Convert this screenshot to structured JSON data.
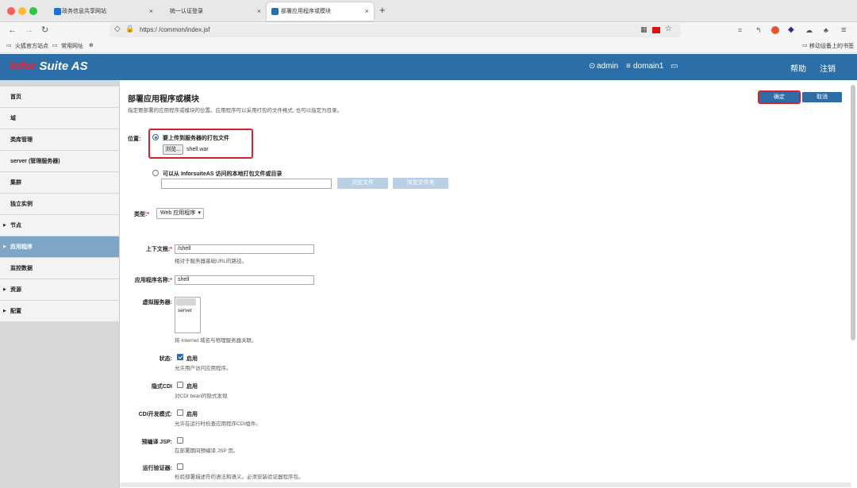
{
  "browser": {
    "tabs": [
      {
        "label": "政务信息共享网站",
        "close": "×"
      },
      {
        "label": "统一认证登录",
        "close": "×"
      },
      {
        "label": "部署应用程序或模块",
        "close": "×"
      }
    ],
    "new_tab": "+",
    "url": "https:/                    /common/index.jsf",
    "bookmarks": [
      "火狐官方站点",
      "常用网址"
    ],
    "mobile_bookmarks": "移动设备上的书签",
    "colors": {
      "tab_bg": "#e8e8e8",
      "dot_red": "#ff5f57",
      "dot_yellow": "#febc2e",
      "dot_green": "#28c840"
    }
  },
  "app": {
    "logo_prefix": "In",
    "logo_mark": "for",
    "logo_suffix": " Suite AS",
    "user": "admin",
    "domain": "domain1",
    "host": "",
    "help": "帮助",
    "logout": "注销",
    "header_color": "#2c6fa8"
  },
  "sidebar": {
    "items": [
      {
        "label": "首页",
        "arrow": ""
      },
      {
        "label": "域",
        "arrow": ""
      },
      {
        "label": "类库管理",
        "arrow": ""
      },
      {
        "label": "server (管理服务器)",
        "arrow": ""
      },
      {
        "label": "集群",
        "arrow": ""
      },
      {
        "label": "独立实例",
        "arrow": ""
      },
      {
        "label": "节点",
        "arrow": "▶"
      },
      {
        "label": "应用程序",
        "arrow": "▶"
      },
      {
        "label": "监控数据",
        "arrow": ""
      },
      {
        "label": "资源",
        "arrow": "▶"
      },
      {
        "label": "配置",
        "arrow": "▶"
      }
    ],
    "selected_index": 7
  },
  "form": {
    "title": "部署应用程序或模块",
    "description": "指定要部署的应用程序或模块的位置。应用程序可以采用打包的文件格式, 也可以指定为目录。",
    "ok": "确定",
    "cancel": "取消",
    "location_label": "位置:",
    "upload_option": "要上传到服务器的打包文件",
    "browse": "浏览...",
    "file_name": "shell.war",
    "local_option": "可以从 InforsuiteAS 访问的本地打包文件或目录",
    "browse_file": "浏览文件",
    "browse_folder": "浏览文件夹",
    "type_label": "类型:",
    "type_value": "Web 应用程序",
    "context_label": "上下文根:",
    "context_value": "/shell",
    "context_help": "相对于服务器基础URL的路径。",
    "appname_label": "应用程序名称:",
    "appname_value": "shell",
    "vserver_label": "虚拟服务器:",
    "vserver_option": "server",
    "vserver_help": "将 Internet 域名与物理服务器关联。",
    "status_label": "状态:",
    "status_check": "启用",
    "status_help": "允许用户访问应用程序。",
    "cdi_label": "隐式CDI",
    "cdi_check": "启用",
    "cdi_help": "对CDI bean的隐式发现",
    "cdidev_label": "CDI开发模式:",
    "cdidev_check": "启用",
    "cdidev_help": "允许在运行时检查应用程序CDI组件。",
    "jsp_label": "预编译 JSP:",
    "jsp_help": "在部署期间预编译 JSP 页。",
    "verifier_label": "运行验证器:",
    "verifier_help": "检验部署描述符的语法和语义。必须安装验证器程序包。"
  }
}
